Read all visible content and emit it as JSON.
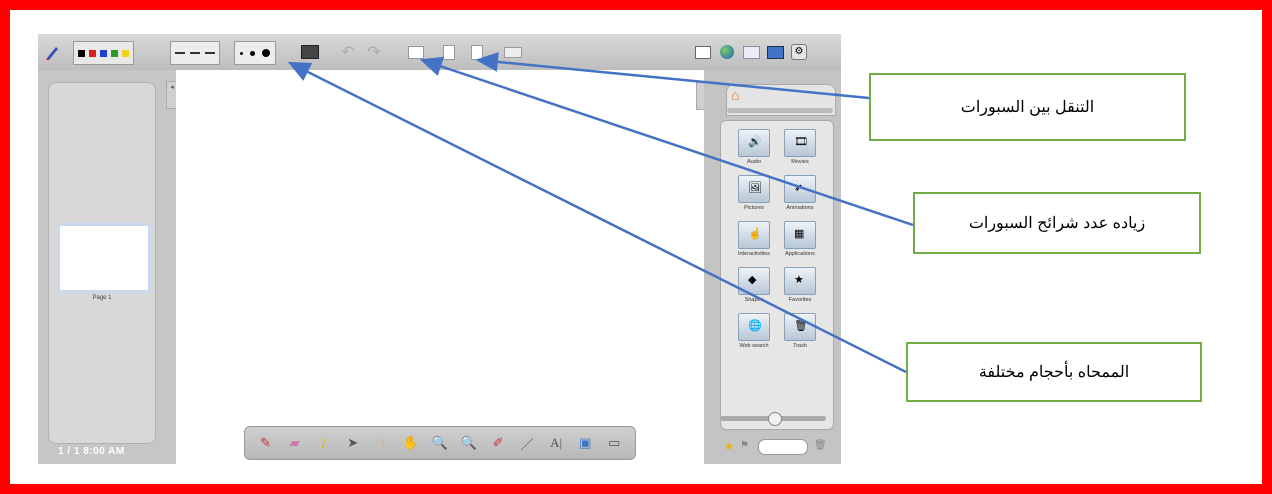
{
  "colors": {
    "frame": "#ff0000",
    "callout_border": "#70ad47",
    "arrow": "#4472c4"
  },
  "toolbar": {
    "pen_icon": "pen-icon",
    "swatches": [
      "#000000",
      "#e02020",
      "#1f3fd0",
      "#2a9a2a",
      "#f3d21c"
    ],
    "line_styles_icon": "line-style-icon",
    "dot_sizes": [
      3,
      5,
      8
    ],
    "right_icons": [
      "display-icon",
      "globe-icon",
      "folder-icon",
      "monitor-icon",
      "settings-icon"
    ]
  },
  "left_sidebar": {
    "page_label": "Page 1",
    "status": "1 / 1    8:00 AM"
  },
  "gallery": {
    "folders": [
      {
        "label": "Audio",
        "glyph": "🔊"
      },
      {
        "label": "Movies",
        "glyph": "🎞"
      },
      {
        "label": "Pictures",
        "glyph": "🖼"
      },
      {
        "label": "Animations",
        "glyph": "➶"
      },
      {
        "label": "Interactivities",
        "glyph": "☝"
      },
      {
        "label": "Applications",
        "glyph": "▦"
      },
      {
        "label": "Shapes",
        "glyph": "◆"
      },
      {
        "label": "Favorites",
        "glyph": "★"
      },
      {
        "label": "Web search",
        "glyph": "🌐"
      },
      {
        "label": "Trash",
        "glyph": "🗑"
      }
    ]
  },
  "callouts": {
    "navigate_slides": "التنقل بين السبورات",
    "add_slides": "زياده عدد شرائح السبورات",
    "eraser_sizes": "الممحاه بأحجام مختلفة"
  }
}
